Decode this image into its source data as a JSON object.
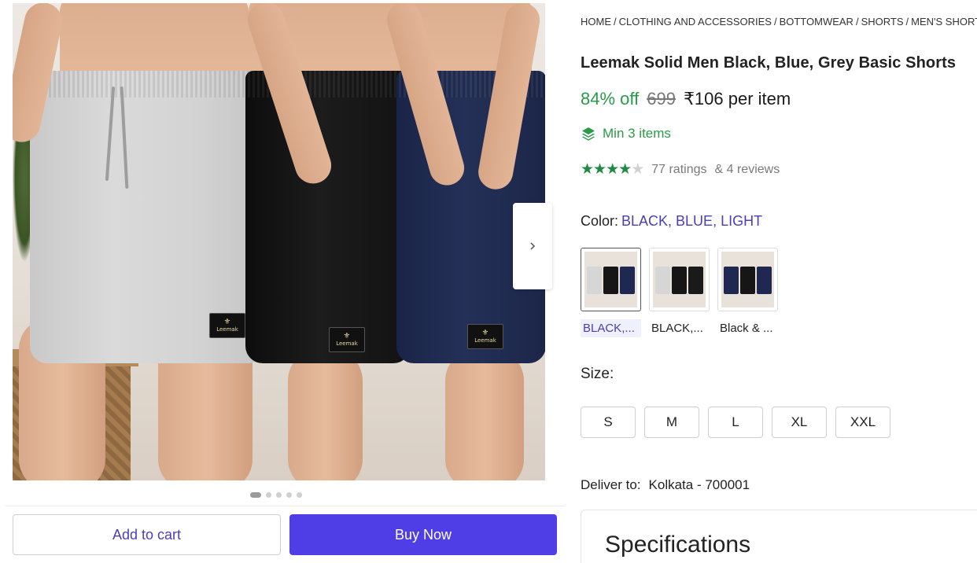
{
  "breadcrumb": [
    "HOME",
    "CLOTHING AND ACCESSORIES",
    "BOTTOMWEAR",
    "SHORTS",
    "MEN'S SHORTS"
  ],
  "product": {
    "title": "Leemak Solid Men Black, Blue, Grey Basic Shorts",
    "discount": "84% off",
    "mrp": "699",
    "price": "₹106 per item",
    "min_items": "Min 3 items",
    "rating_stars": 4,
    "ratings_text": "77 ratings",
    "reviews_text": "& 4 reviews"
  },
  "gallery": {
    "brand_patch": "Leemak",
    "image_count": 5,
    "active_index": 0,
    "next_icon": "chevron-right-icon"
  },
  "color": {
    "label": "Color:",
    "selected": "BLACK, BLUE, LIGHT",
    "options": [
      {
        "label": "BLACK,...",
        "colors": [
          "#d6d6d6",
          "#161616",
          "#1e2850"
        ]
      },
      {
        "label": "BLACK,...",
        "colors": [
          "#d6d6d6",
          "#161616",
          "#1a1a1a"
        ]
      },
      {
        "label": "Black & ...",
        "colors": [
          "#1e2850",
          "#161616",
          "#1e2850"
        ]
      }
    ]
  },
  "size": {
    "label": "Size:",
    "options": [
      "S",
      "M",
      "L",
      "XL",
      "XXL"
    ]
  },
  "delivery": {
    "label": "Deliver to:",
    "location": "Kolkata - 700001"
  },
  "actions": {
    "add_to_cart": "Add to cart",
    "buy_now": "Buy Now"
  },
  "specifications": {
    "title": "Specifications"
  },
  "colors": {
    "accent": "#4f3ee6",
    "accent_text": "#4a3fb3",
    "discount_green": "#2a9a48",
    "star_green": "#1f8a43"
  }
}
